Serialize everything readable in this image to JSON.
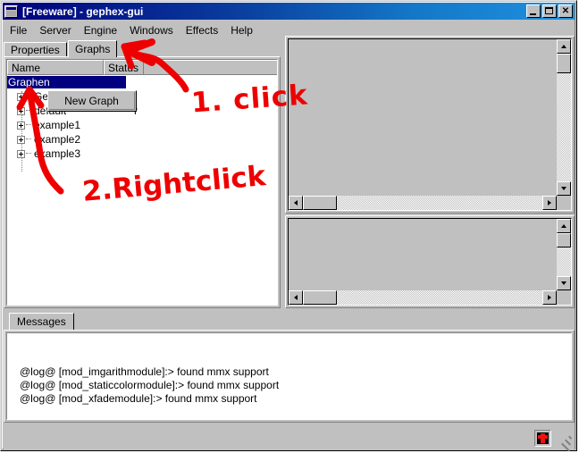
{
  "window": {
    "title": "[Freeware] - gephex-gui",
    "icon": "window-app-icon",
    "controls": [
      {
        "name": "minimize",
        "label": "_"
      },
      {
        "name": "maximize",
        "label": "□"
      },
      {
        "name": "close",
        "label": "✕"
      }
    ]
  },
  "menubar": {
    "items": [
      {
        "label": "File"
      },
      {
        "label": "Server"
      },
      {
        "label": "Engine"
      },
      {
        "label": "Windows"
      },
      {
        "label": "Effects"
      },
      {
        "label": "Help"
      }
    ]
  },
  "left_pane": {
    "tabs": [
      {
        "label": "Properties",
        "active": false
      },
      {
        "label": "Graphs",
        "active": true
      }
    ],
    "columns": [
      {
        "label": "Name"
      },
      {
        "label": "Status"
      }
    ],
    "tree": [
      {
        "label": "Graphen",
        "status": "",
        "selected": true,
        "expandable": false,
        "indent": 0
      },
      {
        "label": "GePh",
        "status": "",
        "selected": false,
        "expandable": true,
        "indent": 1
      },
      {
        "label": "default",
        "status": "r",
        "selected": false,
        "expandable": true,
        "indent": 1
      },
      {
        "label": "example1",
        "status": "",
        "selected": false,
        "expandable": true,
        "indent": 1
      },
      {
        "label": "example2",
        "status": "",
        "selected": false,
        "expandable": true,
        "indent": 1
      },
      {
        "label": "example3",
        "status": "",
        "selected": false,
        "expandable": true,
        "indent": 1
      }
    ],
    "context_menu": {
      "items": [
        {
          "label": "New Graph"
        }
      ]
    }
  },
  "right_panes": [
    {
      "name": "graph-canvas-top"
    },
    {
      "name": "graph-canvas-bottom"
    }
  ],
  "messages": {
    "tab_label": "Messages",
    "lines": [
      "@log@ [mod_imgarithmodule]:> found mmx support",
      "@log@ [mod_staticcolormodule]:> found mmx support",
      "@log@ [mod_xfademodule]:> found mmx support"
    ]
  },
  "statusbar": {
    "icon": "red-cross-status-icon",
    "grip": "resize-grip"
  },
  "annotations": [
    {
      "text": "1. click",
      "color": "#ee0000"
    },
    {
      "text": "2.Rightclick",
      "color": "#ee0000"
    }
  ],
  "colors": {
    "face": "#c0c0c0",
    "title_start": "#00007b",
    "title_end": "#1f91e0",
    "selection": "#000080",
    "annotation": "#ee0000"
  }
}
